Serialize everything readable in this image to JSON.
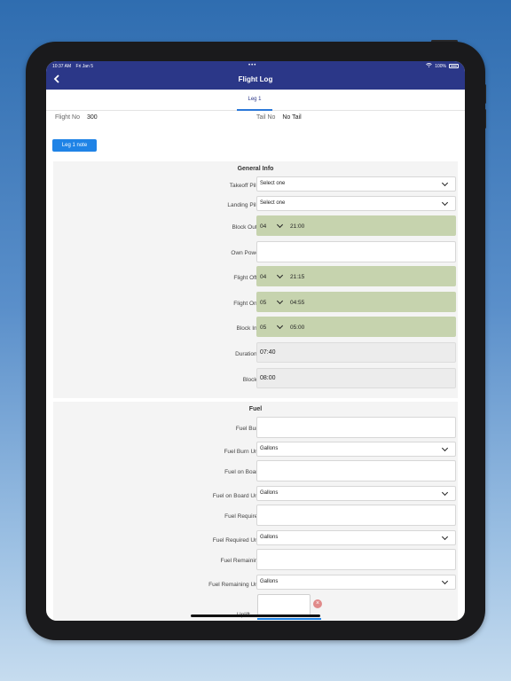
{
  "status": {
    "time": "10:37 AM",
    "date": "Fri Jan 5",
    "dots": "•••",
    "battery": "100%"
  },
  "nav": {
    "title": "Flight Log",
    "back_icon": "chevron-left-icon"
  },
  "tabs": [
    {
      "label": "Leg 1",
      "active": true
    }
  ],
  "flight": {
    "no_label": "Flight No",
    "no_value": "300",
    "tail_label": "Tail No",
    "tail_value": "No Tail"
  },
  "note_button": "Leg 1 note",
  "general": {
    "title": "General Info",
    "takeoff_pilot": {
      "label": "Takeoff Pilot",
      "value": "Select one"
    },
    "landing_pilot": {
      "label": "Landing Pilot",
      "value": "Select one"
    },
    "block_out": {
      "label": "Block Out",
      "day": "04",
      "time": "21:00"
    },
    "own_power": {
      "label": "Own Power",
      "value": ""
    },
    "flight_off": {
      "label": "Flight Off",
      "day": "04",
      "time": "21:15"
    },
    "flight_on": {
      "label": "Flight On",
      "day": "05",
      "time": "04:55"
    },
    "block_in": {
      "label": "Block In",
      "day": "05",
      "time": "05:00"
    },
    "duration": {
      "label": "Duration",
      "value": "07:40"
    },
    "block": {
      "label": "Block",
      "value": "08:00"
    }
  },
  "fuel": {
    "title": "Fuel",
    "burn": {
      "label": "Fuel Burn",
      "value": ""
    },
    "burn_unit": {
      "label": "Fuel Burn Unit",
      "value": "Gallons"
    },
    "on_board": {
      "label": "Fuel on Board",
      "value": ""
    },
    "on_board_unit": {
      "label": "Fuel on Board Unit",
      "value": "Gallons"
    },
    "required": {
      "label": "Fuel Required",
      "value": ""
    },
    "required_unit": {
      "label": "Fuel Required Unit",
      "value": "Gallons"
    },
    "remaining": {
      "label": "Fuel Remaining",
      "value": ""
    },
    "remaining_unit": {
      "label": "Fuel Remaining Unit",
      "value": "Gallons"
    },
    "uplift": {
      "label": "Uplift",
      "value": ""
    }
  },
  "required_mark": "*",
  "colors": {
    "nav": "#2b3788",
    "accent": "#1f83e6",
    "time_field": "#c6d3ae",
    "required": "#d43a3a"
  }
}
